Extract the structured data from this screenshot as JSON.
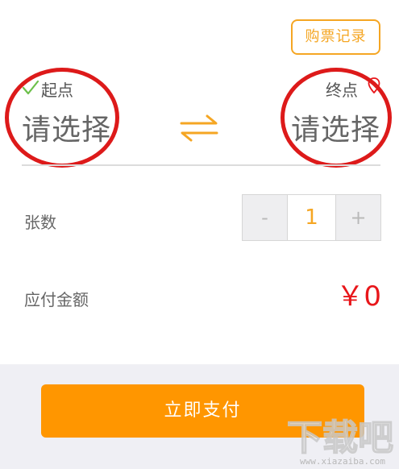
{
  "header": {
    "history_label": "购票记录"
  },
  "route": {
    "origin_label": "起点",
    "origin_value": "请选择",
    "destination_label": "终点",
    "destination_value": "请选择"
  },
  "quantity": {
    "label": "张数",
    "minus": "-",
    "value": "1",
    "plus": "+"
  },
  "amount": {
    "label": "应付金额",
    "value": "￥0"
  },
  "footer": {
    "pay_label": "立即支付"
  },
  "watermark": {
    "text": "下载吧",
    "url_text": "www.xiazaiba.com"
  },
  "colors": {
    "accent": "#f5a623",
    "pay_button": "#ff9600",
    "amount": "#e8161a",
    "annotation_circle": "#dd1a1a"
  },
  "icons": {
    "check": "check-icon",
    "pin": "location-pin-icon",
    "swap": "swap-arrows-icon"
  }
}
